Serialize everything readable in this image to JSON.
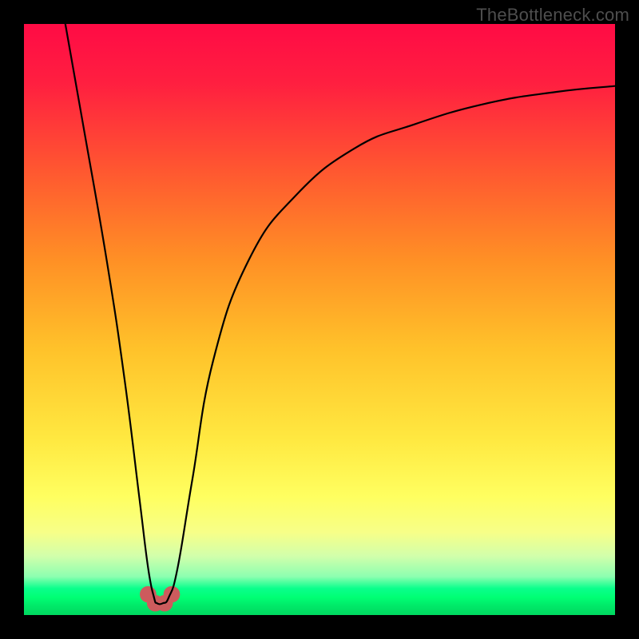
{
  "watermark": "TheBottleneck.com",
  "chart_data": {
    "type": "line",
    "title": "",
    "xlabel": "",
    "ylabel": "",
    "xlim": [
      0,
      100
    ],
    "ylim": [
      0,
      100
    ],
    "grid": false,
    "legend": false,
    "annotations": [],
    "notch": {
      "x": 23,
      "y_min": 2,
      "floor_width": 5
    },
    "series": [
      {
        "name": "curve",
        "color": "#000000",
        "x": [
          7,
          10,
          14,
          17,
          19.5,
          21,
          22,
          22.5,
          23.5,
          24.5,
          26,
          28.5,
          32,
          38,
          46,
          56,
          66,
          78,
          90,
          100
        ],
        "y": [
          100,
          83,
          60,
          40,
          20,
          8,
          3,
          2,
          2,
          3,
          8,
          23,
          43,
          60,
          71,
          79,
          83,
          86.5,
          88.5,
          89.5
        ]
      }
    ],
    "blobs": [
      {
        "cx": 21.0,
        "cy": 3.5,
        "r": 1.4,
        "color": "#cd5b5d"
      },
      {
        "cx": 22.2,
        "cy": 2.0,
        "r": 1.4,
        "color": "#cd5b5d"
      },
      {
        "cx": 23.8,
        "cy": 2.0,
        "r": 1.4,
        "color": "#cd5b5d"
      },
      {
        "cx": 25.0,
        "cy": 3.5,
        "r": 1.4,
        "color": "#cd5b5d"
      }
    ]
  }
}
